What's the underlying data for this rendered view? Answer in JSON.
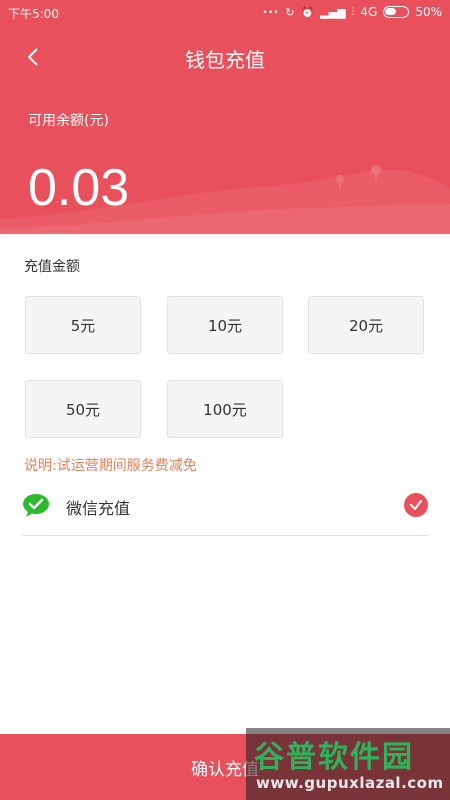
{
  "status_bar": {
    "time": "下午5:00",
    "network": "4G",
    "battery": "50%"
  },
  "header": {
    "title": "钱包充值",
    "balance_label": "可用余额(元)",
    "balance_value": "0.03"
  },
  "recharge": {
    "section_title": "充值金额",
    "amounts": [
      "5元",
      "10元",
      "20元",
      "50元",
      "100元"
    ],
    "note": "说明:试运营期间服务费减免"
  },
  "payment": {
    "method_label": "微信充值",
    "selected": true
  },
  "footer": {
    "confirm_label": "确认充值"
  },
  "watermark": {
    "title": "谷普软件园",
    "url": "www.gupuxlazal.com"
  },
  "colors": {
    "primary": "#e8505b",
    "note": "#e8805b",
    "wechat": "#2dbb2d"
  }
}
